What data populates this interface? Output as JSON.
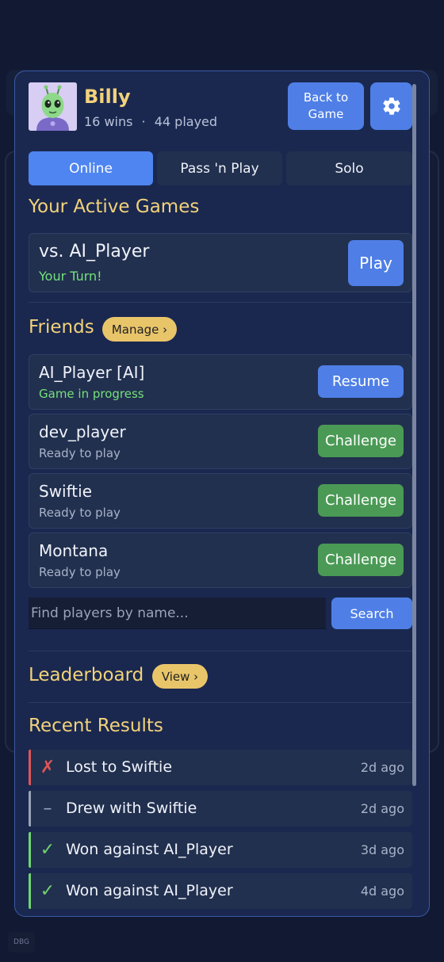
{
  "profile": {
    "name": "Billy",
    "wins": "16 wins",
    "separator": "·",
    "played": "44 played"
  },
  "header": {
    "back_line1": "Back to",
    "back_line2": "Game",
    "settings_icon": "gear-icon"
  },
  "tabs": [
    {
      "label": "Online",
      "active": true
    },
    {
      "label": "Pass 'n Play",
      "active": false
    },
    {
      "label": "Solo",
      "active": false
    }
  ],
  "active_games": {
    "title": "Your Active Games",
    "games": [
      {
        "opponent": "vs. AI_Player",
        "status": "Your Turn!",
        "action": "Play"
      }
    ]
  },
  "friends": {
    "title": "Friends",
    "manage_label": "Manage ›",
    "items": [
      {
        "name": "AI_Player  [AI]",
        "status": "Game in progress",
        "action": "Resume"
      },
      {
        "name": "dev_player",
        "status": "Ready to play",
        "action": "Challenge"
      },
      {
        "name": "Swiftie",
        "status": "Ready to play",
        "action": "Challenge"
      },
      {
        "name": "Montana",
        "status": "Ready to play",
        "action": "Challenge"
      }
    ],
    "search_placeholder": "Find players by name...",
    "search_label": "Search"
  },
  "leaderboard": {
    "title": "Leaderboard",
    "view_label": "View ›"
  },
  "recent_results": {
    "title": "Recent Results",
    "items": [
      {
        "mark": "✗",
        "text": "Lost to Swiftie",
        "time": "2d ago",
        "outcome": "loss",
        "color": "#e05555"
      },
      {
        "mark": "–",
        "text": "Drew with Swiftie",
        "time": "2d ago",
        "outcome": "draw",
        "color": "#9aa3b8"
      },
      {
        "mark": "✓",
        "text": "Won against AI_Player",
        "time": "3d ago",
        "outcome": "win",
        "color": "#6fd36f"
      },
      {
        "mark": "✓",
        "text": "Won against AI_Player",
        "time": "4d ago",
        "outcome": "win",
        "color": "#6fd36f"
      }
    ]
  },
  "debug_badge": "DBG",
  "colors": {
    "accent_blue": "#4f7fe6",
    "accent_green": "#4a9a55",
    "title_gold": "#f2d27a",
    "pill_gold": "#e9c56a",
    "panel_bg": "#1a2850"
  }
}
